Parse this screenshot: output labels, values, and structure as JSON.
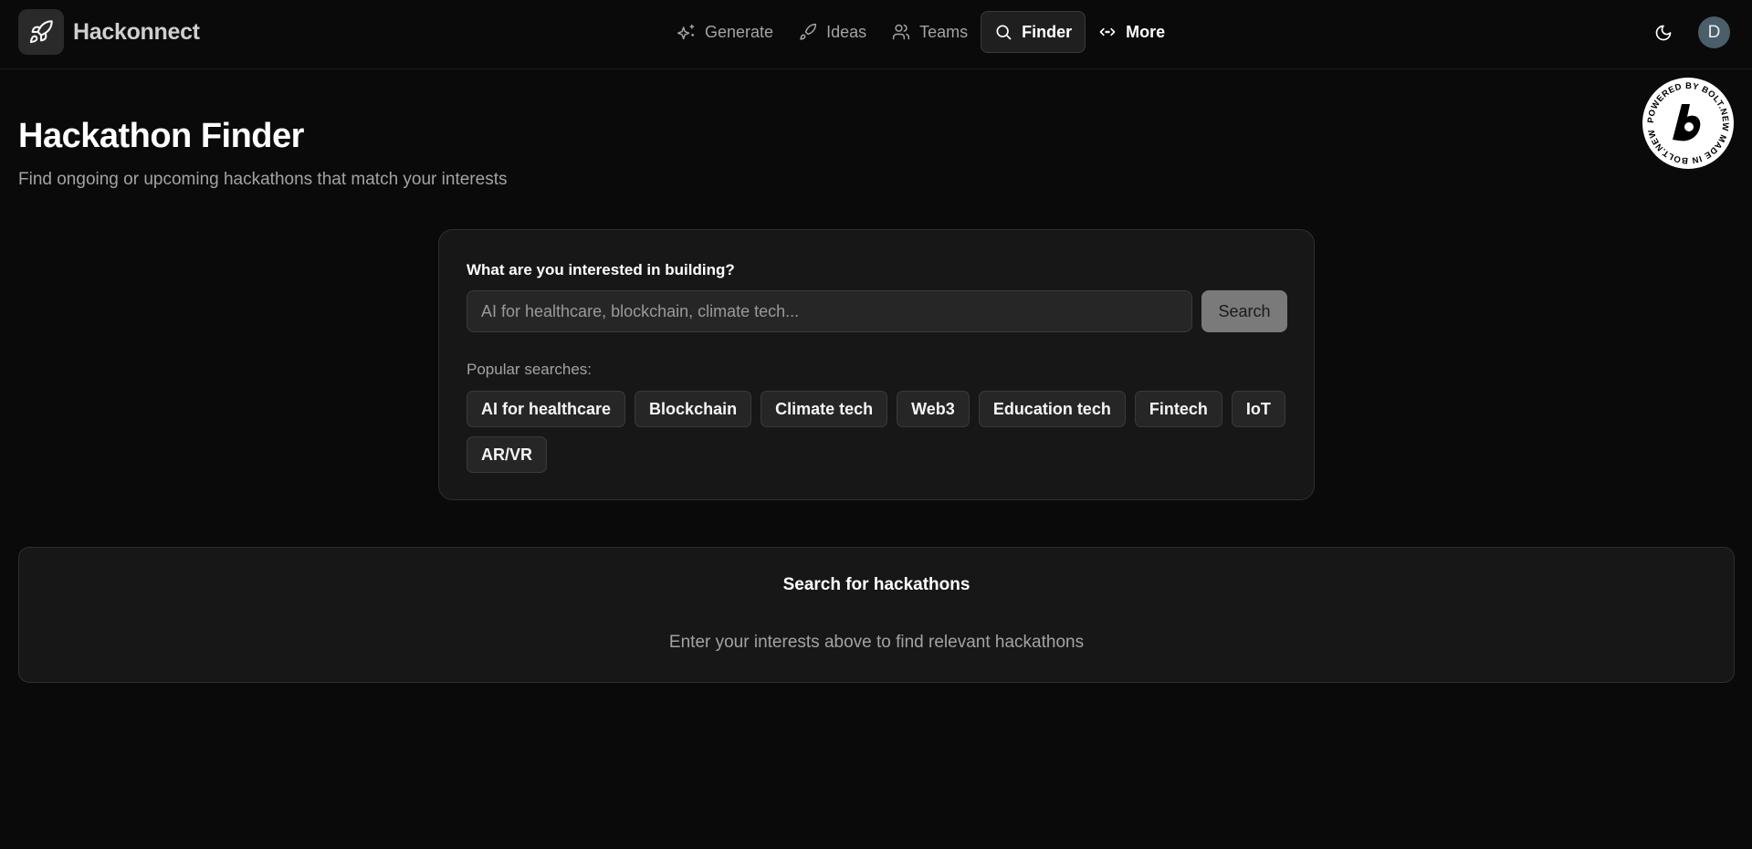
{
  "brand": {
    "name": "Hackonnect",
    "icon": "rocket-icon"
  },
  "nav": {
    "items": [
      {
        "label": "Generate",
        "icon": "sparkles-icon"
      },
      {
        "label": "Ideas",
        "icon": "rocket-icon"
      },
      {
        "label": "Teams",
        "icon": "users-icon"
      },
      {
        "label": "Finder",
        "icon": "search-icon",
        "active": true
      },
      {
        "label": "More",
        "icon": "code-icon"
      }
    ]
  },
  "header": {
    "theme_icon": "moon-icon",
    "avatar_initial": "D"
  },
  "badge": {
    "text": "POWERED BY BOLT.NEW MADE IN BOLT.NEW"
  },
  "page": {
    "title": "Hackathon Finder",
    "subtitle": "Find ongoing or upcoming hackathons that match your interests"
  },
  "search": {
    "label": "What are you interested in building?",
    "placeholder": "AI for healthcare, blockchain, climate tech...",
    "value": "",
    "button_label": "Search",
    "popular_label": "Popular searches:",
    "popular": [
      "AI for healthcare",
      "Blockchain",
      "Climate tech",
      "Web3",
      "Education tech",
      "Fintech",
      "IoT",
      "AR/VR"
    ]
  },
  "empty_state": {
    "title": "Search for hackathons",
    "text": "Enter your interests above to find relevant hackathons"
  },
  "colors": {
    "background": "#0a0a0a",
    "card": "#171717",
    "muted_text": "#a3a3a3",
    "button": "#7a7a7a",
    "avatar": "#4a5f6a"
  }
}
